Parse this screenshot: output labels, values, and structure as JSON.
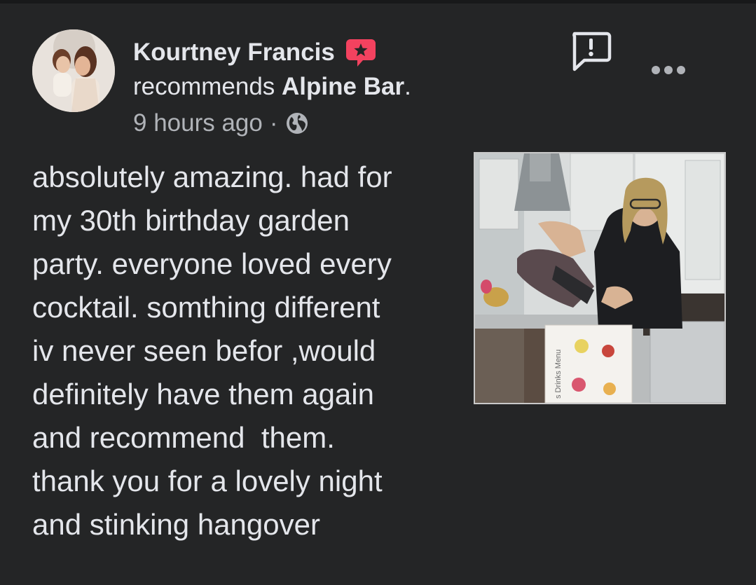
{
  "post": {
    "author": "Kourtney Francis",
    "recommends_prefix": "recommends ",
    "page_name": "Alpine Bar",
    "recommends_suffix": ".",
    "time": "9 hours ago",
    "separator": "·",
    "privacy_icon": "globe-icon",
    "badge_icon": "recommendation-star-badge-icon",
    "report_icon": "report-exclamation-icon",
    "more_icon": "more-options-icon",
    "body": "absolutely amazing. had for\nmy 30th birthday garden\nparty. everyone loved every\ncocktail. somthing different\niv never seen befor ,would\ndefinitely have them again\nand recommend  them.\nthank you for a lovely night\nand stinking hangover",
    "photo": {
      "sign_text": "s Drinks Menu"
    }
  },
  "colors": {
    "background": "#242526",
    "text_primary": "#e4e6eb",
    "text_secondary": "#b0b3b8",
    "badge": "#f3425f"
  }
}
